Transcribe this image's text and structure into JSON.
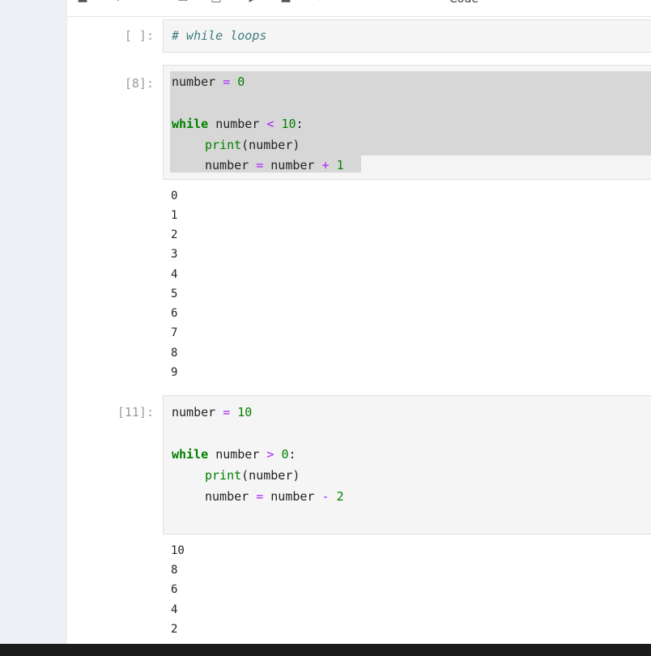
{
  "toolbar": {
    "icons": [
      "save-icon",
      "add-icon",
      "cut-icon",
      "copy-icon",
      "paste-icon",
      "run-icon",
      "stop-icon",
      "restart-icon",
      "fast-forward-icon"
    ],
    "cell_type": "Code"
  },
  "cells": [
    {
      "prompt": "[ ]:",
      "comment": "# while loops"
    },
    {
      "prompt": "[8]:",
      "line1": {
        "var": "number",
        "eq": "=",
        "num": "0"
      },
      "line2": {
        "kw": "while",
        "var": "number",
        "op": "<",
        "num": "10",
        "colon": ":"
      },
      "line3": {
        "fn": "print",
        "arg": "(number)"
      },
      "line4": {
        "var": "number",
        "eq": "=",
        "var2": "number",
        "op": "+",
        "num": "1"
      },
      "outputs": [
        "0",
        "1",
        "2",
        "3",
        "4",
        "5",
        "6",
        "7",
        "8",
        "9"
      ]
    },
    {
      "prompt": "[11]:",
      "line1": {
        "var": "number",
        "eq": "=",
        "num": "10"
      },
      "line2": {
        "kw": "while",
        "var": "number",
        "op": ">",
        "num": "0",
        "colon": ":"
      },
      "line3": {
        "fn": "print",
        "arg": "(number)"
      },
      "line4": {
        "var": "number",
        "eq": "=",
        "var2": "number",
        "op": "-",
        "num": "2"
      },
      "outputs": [
        "10",
        "8",
        "6",
        "4",
        "2"
      ]
    }
  ]
}
